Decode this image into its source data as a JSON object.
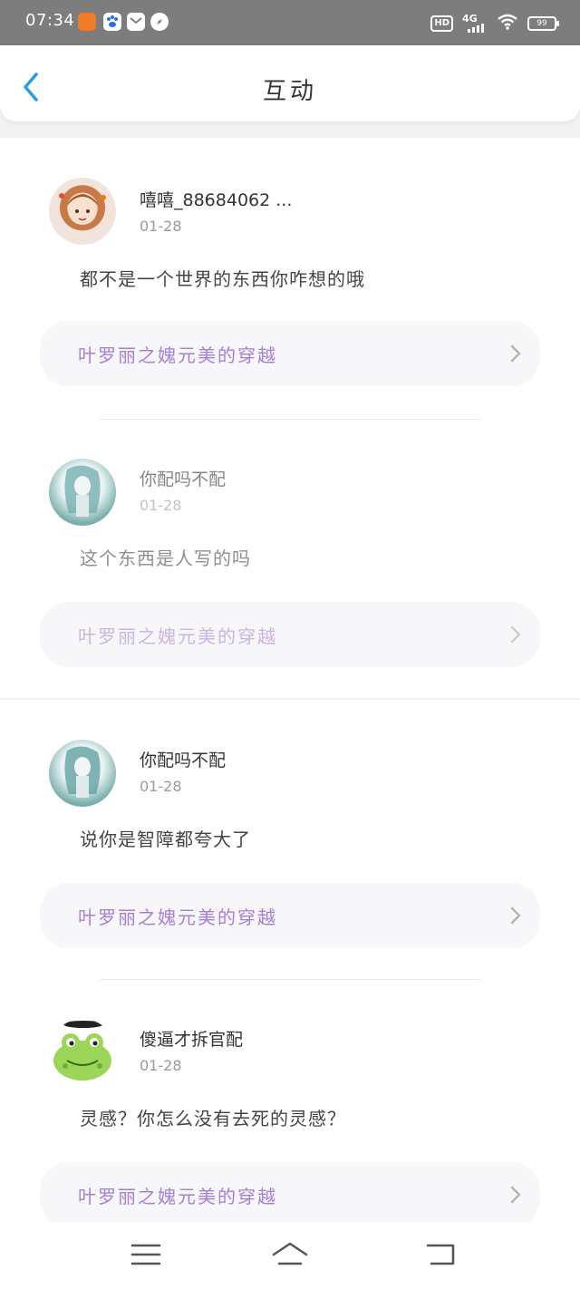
{
  "status_bar": {
    "time": "07:34",
    "hd": "HD",
    "network": "4G",
    "battery": "99"
  },
  "header": {
    "title": "互动"
  },
  "comments": [
    {
      "username": "嘻嘻_88684062 ...",
      "date": "01-28",
      "text": "都不是一个世界的东西你咋想的哦",
      "link": "叶罗丽之媿元美的穿越"
    },
    {
      "username": "你配吗不配",
      "date": "01-28",
      "text": "这个东西是人写的吗",
      "link": "叶罗丽之媿元美的穿越"
    },
    {
      "username": "你配吗不配",
      "date": "01-28",
      "text": "说你是智障都夸大了",
      "link": "叶罗丽之媿元美的穿越"
    },
    {
      "username": "傻逼才拆官配",
      "date": "01-28",
      "text": "灵感？你怎么没有去死的灵感？",
      "link": "叶罗丽之媿元美的穿越"
    }
  ],
  "colors": {
    "link_purple": "#a77ed8",
    "back_blue": "#2a9ce6",
    "status_gray": "#7d7d7d"
  }
}
